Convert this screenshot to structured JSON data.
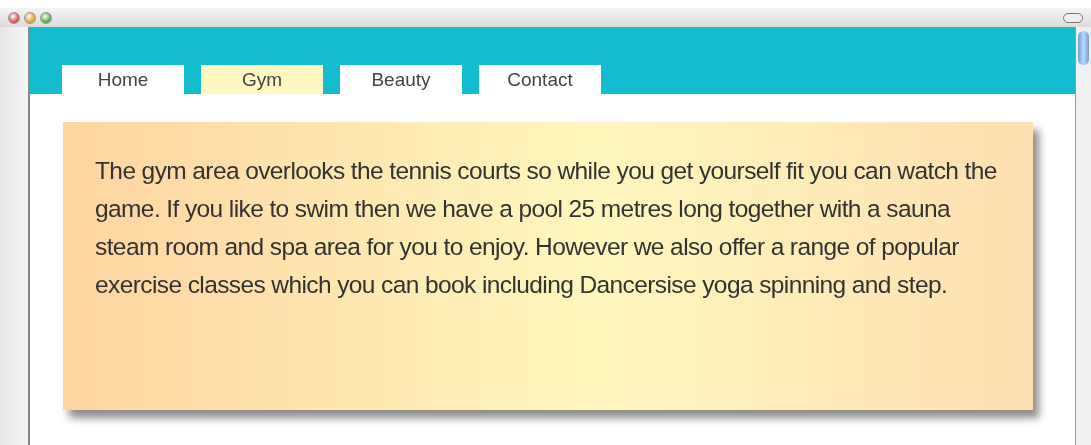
{
  "tabs": [
    {
      "label": "Home",
      "selected": false
    },
    {
      "label": "Gym",
      "selected": true
    },
    {
      "label": "Beauty",
      "selected": false
    },
    {
      "label": "Contact",
      "selected": false
    }
  ],
  "content": {
    "text": "The gym area overlooks the tennis courts so while you get yourself fit you can watch the game. If you like to swim then we have a pool 25 metres long together with a sauna steam room and spa area for you to enjoy. However we also offer a range of popular exercise classes which you can book including Dancersise yoga spinning and step."
  }
}
